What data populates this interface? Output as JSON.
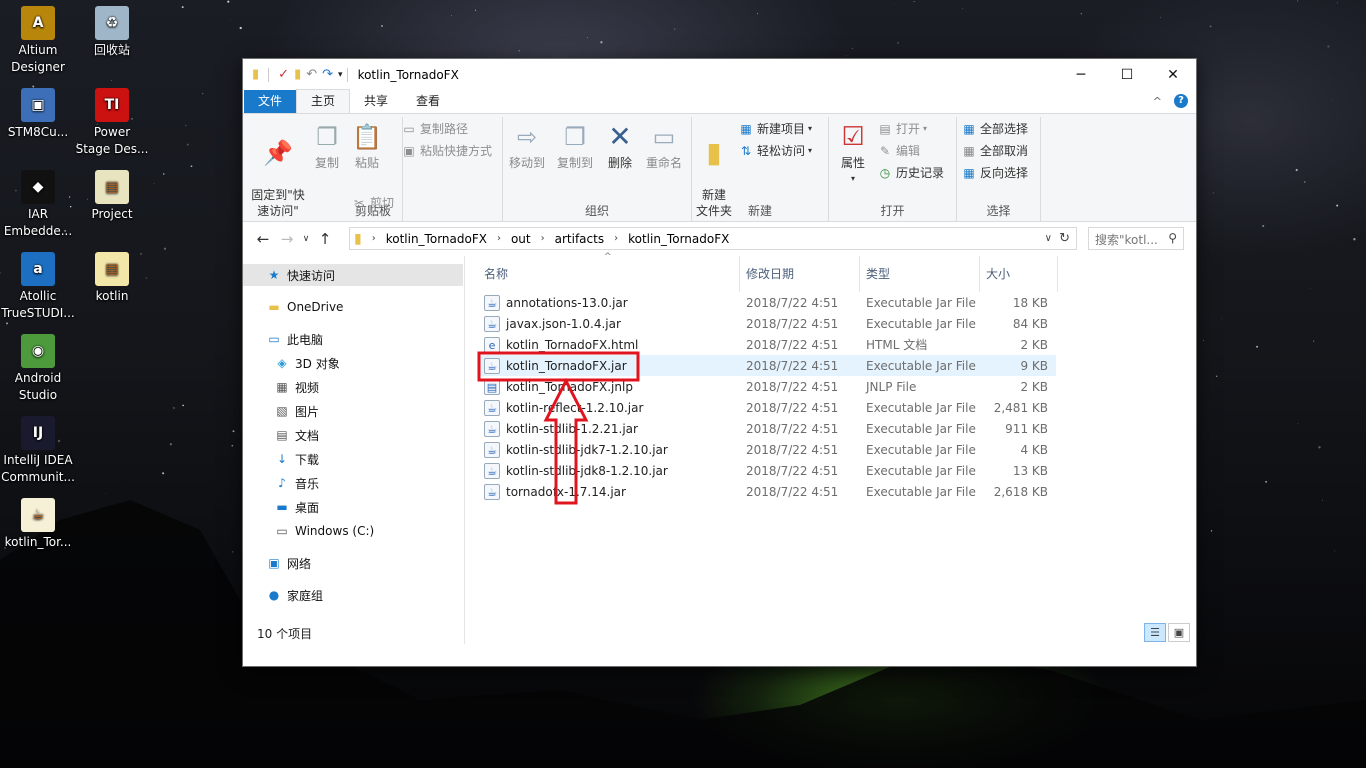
{
  "desktop": {
    "icons": [
      {
        "label": "Altium\nDesigner",
        "icon": "altium-icon",
        "glyph": "A",
        "color": "#b8860b"
      },
      {
        "label": "回收站",
        "icon": "recycle-bin-icon",
        "glyph": "♻",
        "color": "#9fb6c8"
      },
      {
        "label": "STM8Cu...",
        "icon": "stm8-icon",
        "glyph": "▣",
        "color": "#3d6fb8"
      },
      {
        "label": "Power\nStage Des...",
        "icon": "ti-icon",
        "glyph": "TI",
        "color": "#cc1111"
      },
      {
        "label": "IAR\nEmbedde...",
        "icon": "iar-icon",
        "glyph": "◆",
        "color": "#111111"
      },
      {
        "label": "Project",
        "icon": "document-icon",
        "glyph": "▤",
        "color": "#e8e4c0"
      },
      {
        "label": "Atollic\nTrueSTUDI...",
        "icon": "atollic-icon",
        "glyph": "a",
        "color": "#1d6fc2"
      },
      {
        "label": "kotlin",
        "icon": "document-icon",
        "glyph": "▤",
        "color": "#f2e6a8"
      },
      {
        "label": "Android\nStudio",
        "icon": "android-studio-icon",
        "glyph": "◉",
        "color": "#4c9a3c"
      },
      {
        "label": "IntelliJ IDEA\nCommunit...",
        "icon": "intellij-icon",
        "glyph": "IJ",
        "color": "#1a1a2e"
      },
      {
        "label": "kotlin_Tor...",
        "icon": "jar-file-icon",
        "glyph": "☕",
        "color": "#f5f0d6"
      }
    ]
  },
  "window": {
    "title": "kotlin_TornadoFX",
    "controls": {
      "minimize": "─",
      "maximize": "☐",
      "close": "✕"
    },
    "tabs": [
      "文件",
      "主页",
      "共享",
      "查看"
    ],
    "help": "?",
    "collapse": "^",
    "ribbon": {
      "clipboard": {
        "pin": "固定到\"快\n速访问\"",
        "copy": "复制",
        "paste": "粘贴",
        "copy_path": "复制路径",
        "paste_shortcut": "粘贴快捷方式",
        "cut": "剪切",
        "name": "剪贴板"
      },
      "organize": {
        "move_to": "移动到",
        "copy_to": "复制到",
        "delete": "删除",
        "rename": "重命名",
        "name": "组织"
      },
      "new": {
        "new_folder": "新建\n文件夹",
        "new_item": "新建项目",
        "easy_access": "轻松访问",
        "name": "新建"
      },
      "open": {
        "properties": "属性",
        "open": "打开",
        "edit": "编辑",
        "history": "历史记录",
        "name": "打开"
      },
      "select": {
        "select_all": "全部选择",
        "select_none": "全部取消",
        "invert": "反向选择",
        "name": "选择"
      }
    },
    "address": {
      "crumbs": [
        "kotlin_TornadoFX",
        "out",
        "artifacts",
        "kotlin_TornadoFX"
      ],
      "search_placeholder": "搜索\"kotl..."
    },
    "nav": {
      "items": [
        {
          "label": "快速访问",
          "icon": "star-icon",
          "glyph": "★",
          "indent": 0,
          "selected": true
        },
        {
          "label": "OneDrive",
          "icon": "folder-icon",
          "glyph": "▬",
          "indent": 0,
          "selected": false
        },
        {
          "label": "此电脑",
          "icon": "computer-icon",
          "glyph": "▭",
          "indent": 0,
          "selected": false
        },
        {
          "label": "3D 对象",
          "icon": "3d-objects-icon",
          "glyph": "◈",
          "indent": 1,
          "selected": false
        },
        {
          "label": "视频",
          "icon": "video-icon",
          "glyph": "▦",
          "indent": 1,
          "selected": false
        },
        {
          "label": "图片",
          "icon": "pictures-icon",
          "glyph": "▧",
          "indent": 1,
          "selected": false
        },
        {
          "label": "文档",
          "icon": "documents-icon",
          "glyph": "▤",
          "indent": 1,
          "selected": false
        },
        {
          "label": "下载",
          "icon": "download-icon",
          "glyph": "↓",
          "indent": 1,
          "selected": false
        },
        {
          "label": "音乐",
          "icon": "music-icon",
          "glyph": "♪",
          "indent": 1,
          "selected": false
        },
        {
          "label": "桌面",
          "icon": "desktop-icon",
          "glyph": "▬",
          "indent": 1,
          "selected": false
        },
        {
          "label": "Windows (C:)",
          "icon": "drive-icon",
          "glyph": "▭",
          "indent": 1,
          "selected": false
        },
        {
          "label": "网络",
          "icon": "network-icon",
          "glyph": "▣",
          "indent": 0,
          "selected": false
        },
        {
          "label": "家庭组",
          "icon": "homegroup-icon",
          "glyph": "●",
          "indent": 0,
          "selected": false
        }
      ]
    },
    "columns": [
      "名称",
      "修改日期",
      "类型",
      "大小"
    ],
    "files": [
      {
        "name": "annotations-13.0.jar",
        "date": "2018/7/22 4:51",
        "type": "Executable Jar File",
        "size": "18 KB",
        "icon": "jar-file-icon",
        "glyph": "☕"
      },
      {
        "name": "javax.json-1.0.4.jar",
        "date": "2018/7/22 4:51",
        "type": "Executable Jar File",
        "size": "84 KB",
        "icon": "jar-file-icon",
        "glyph": "☕"
      },
      {
        "name": "kotlin_TornadoFX.html",
        "date": "2018/7/22 4:51",
        "type": "HTML 文档",
        "size": "2 KB",
        "icon": "html-file-icon",
        "glyph": "e"
      },
      {
        "name": "kotlin_TornadoFX.jar",
        "date": "2018/7/22 4:51",
        "type": "Executable Jar File",
        "size": "9 KB",
        "icon": "jar-file-icon",
        "glyph": "☕"
      },
      {
        "name": "kotlin_TornadoFX.jnlp",
        "date": "2018/7/22 4:51",
        "type": "JNLP File",
        "size": "2 KB",
        "icon": "jnlp-file-icon",
        "glyph": "▤"
      },
      {
        "name": "kotlin-reflect-1.2.10.jar",
        "date": "2018/7/22 4:51",
        "type": "Executable Jar File",
        "size": "2,481 KB",
        "icon": "jar-file-icon",
        "glyph": "☕"
      },
      {
        "name": "kotlin-stdlib-1.2.21.jar",
        "date": "2018/7/22 4:51",
        "type": "Executable Jar File",
        "size": "911 KB",
        "icon": "jar-file-icon",
        "glyph": "☕"
      },
      {
        "name": "kotlin-stdlib-jdk7-1.2.10.jar",
        "date": "2018/7/22 4:51",
        "type": "Executable Jar File",
        "size": "4 KB",
        "icon": "jar-file-icon",
        "glyph": "☕"
      },
      {
        "name": "kotlin-stdlib-jdk8-1.2.10.jar",
        "date": "2018/7/22 4:51",
        "type": "Executable Jar File",
        "size": "13 KB",
        "icon": "jar-file-icon",
        "glyph": "☕"
      },
      {
        "name": "tornadofx-1.7.14.jar",
        "date": "2018/7/22 4:51",
        "type": "Executable Jar File",
        "size": "2,618 KB",
        "icon": "jar-file-icon",
        "glyph": "☕"
      }
    ],
    "highlighted_file_index": 3,
    "status": "10 个项目",
    "annotation_color": "#e0141e"
  }
}
